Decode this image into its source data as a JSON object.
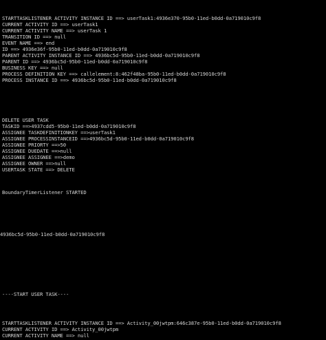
{
  "console": {
    "background": "#000000",
    "foreground": "#d6d6d6",
    "lines": [
      "STARTTASKLISTENER ACTIVITY INSTANCE ID ==> userTask1:4936e370-95b0-11ed-b0dd-0a719010c9f8",
      "CURRENT ACTIVITY ID ==> userTask1",
      "CURRENT ACTIVITY NAME ==> userTask 1",
      "TRANSITION ID ==> null",
      "EVENT NAME ==> end",
      "ID ==> 4936e36f-95b0-11ed-b0dd-0a719010c9f8",
      "PARENT ACTIVITY INSTANCE ID ==> 4936bc5d-95b0-11ed-b0dd-0a719010c9f8",
      "PARENT ID ==> 4936bc5d-95b0-11ed-b0dd-0a719010c9f8",
      "BUSINESS KEY ==> null",
      "PROCESS DEFINITION KEY ==> callelement:8:462f48ba-95b0-11ed-b0dd-0a719010c9f8",
      "PROCESS INSTANCE ID ==> 4936bc5d-95b0-11ed-b0dd-0a719010c9f8",
      "DELETE USER TASK",
      "TASKID ==>4937cdd5-95b0-11ed-b0dd-0a719010c9f8",
      "ASSIGNEE TASKDEFINITIONKEY ==>userTask1",
      "ASSIGNEE PROCESSINSTANCEID ==>4936bc5d-95b0-11ed-b0dd-0a719010c9f8",
      "ASSIGNEE PRIORTY ==>50",
      "ASSIGNEE DUEDATE ==>null",
      "ASSIGNEE ASSIGNEE ==>demo",
      "ASSIGNEE OWNER ==>null",
      "USERTASK STATE ==> DELETE",
      "BoundaryTimerListener STARTED",
      "4936bc5d-95b0-11ed-b0dd-0a719010c9f8",
      "----START USER TASK----",
      "STARTTASKLISTENER ACTIVITY INSTANCE ID ==> Activity_00jwtpm:646c387e-95b0-11ed-b0dd-0a719010c9f8",
      "CURRENT ACTIVITY ID ==> Activity_00jwtpm",
      "CURRENT ACTIVITY NAME ==> null"
    ]
  }
}
